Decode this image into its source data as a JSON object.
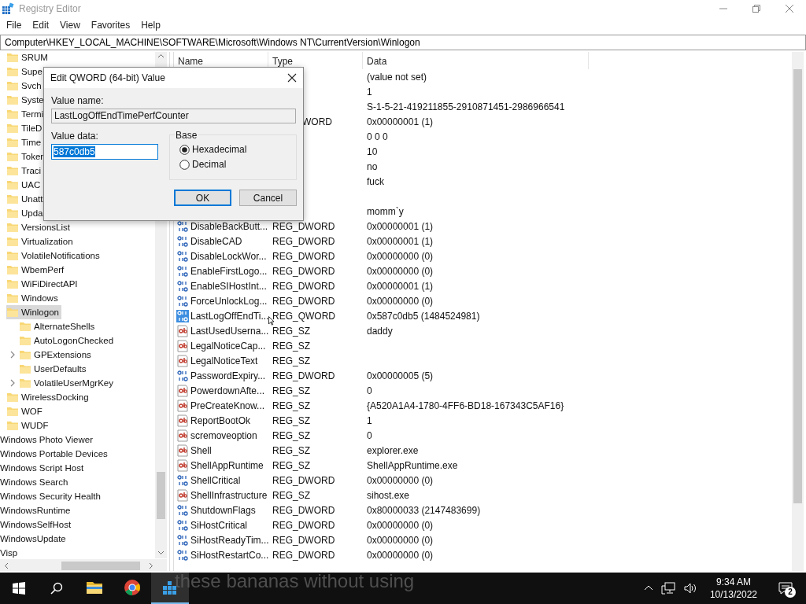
{
  "window": {
    "title": "Registry Editor"
  },
  "menu": [
    "File",
    "Edit",
    "View",
    "Favorites",
    "Help"
  ],
  "address": "Computer\\HKEY_LOCAL_MACHINE\\SOFTWARE\\Microsoft\\Windows NT\\CurrentVersion\\Winlogon",
  "tree": {
    "items": [
      {
        "children": [
          {
            "label": "SRUM",
            "selected": false
          },
          {
            "label": "Supe",
            "selected": false
          },
          {
            "label": "Svch",
            "selected": false
          },
          {
            "label": "Syste",
            "selected": false
          },
          {
            "label": "Termi",
            "selected": false
          },
          {
            "label": "TileD",
            "selected": false
          },
          {
            "label": "Time",
            "selected": false
          },
          {
            "label": "Toker",
            "selected": false
          },
          {
            "label": "Traci",
            "selected": false
          },
          {
            "label": "UAC",
            "selected": false
          },
          {
            "label": "Unatt",
            "selected": false
          },
          {
            "label": "Upda",
            "selected": false
          },
          {
            "label": "VersionsList",
            "selected": false
          },
          {
            "label": "Virtualization",
            "selected": false
          },
          {
            "label": "VolatileNotifications",
            "selected": false
          },
          {
            "label": "WbemPerf",
            "selected": false
          },
          {
            "label": "WiFiDirectAPI",
            "selected": false
          },
          {
            "label": "Windows",
            "selected": false
          },
          {
            "label": "Winlogon",
            "selected": true,
            "children": [
              {
                "label": "AlternateShells",
                "selected": false,
                "has_children": false
              },
              {
                "label": "AutoLogonChecked",
                "selected": false,
                "has_children": false
              },
              {
                "label": "GPExtensions",
                "selected": false,
                "has_children": true
              },
              {
                "label": "UserDefaults",
                "selected": false,
                "has_children": false
              },
              {
                "label": "VolatileUserMgrKey",
                "selected": false,
                "has_children": true
              }
            ]
          },
          {
            "label": "WirelessDocking",
            "selected": false
          },
          {
            "label": "WOF",
            "selected": false
          },
          {
            "label": "WUDF",
            "selected": false
          }
        ]
      },
      {
        "label": "Windows Photo Viewer",
        "selected": false
      },
      {
        "label": "Windows Portable Devices",
        "selected": false
      },
      {
        "label": "Windows Script Host",
        "selected": false
      },
      {
        "label": "Windows Search",
        "selected": false
      },
      {
        "label": "Windows Security Health",
        "selected": false
      },
      {
        "label": "WindowsRuntime",
        "selected": false
      },
      {
        "label": "WindowsSelfHost",
        "selected": false
      },
      {
        "label": "WindowsUpdate",
        "selected": false
      },
      {
        "label": "Visp",
        "selected": false
      }
    ]
  },
  "list": {
    "columns": [
      "Name",
      "Type",
      "Data"
    ],
    "rows": [
      {
        "data": "(value not set)"
      },
      {
        "data": "1"
      },
      {
        "data": "S-1-5-21-419211855-2910871451-2986966541"
      },
      {
        "type": "WORD",
        "data": "0x00000001 (1)"
      },
      {
        "data": "0 0 0"
      },
      {
        "data": "10"
      },
      {
        "data": "no"
      },
      {
        "data": "fuck"
      },
      {},
      {
        "data": "momm`y"
      },
      {
        "kind": "binary",
        "name": "DisableBackButt...",
        "type": "REG_DWORD",
        "data": "0x00000001 (1)",
        "selected": false
      },
      {
        "kind": "binary",
        "name": "DisableCAD",
        "type": "REG_DWORD",
        "data": "0x00000001 (1)",
        "selected": false
      },
      {
        "kind": "binary",
        "name": "DisableLockWor...",
        "type": "REG_DWORD",
        "data": "0x00000000 (0)",
        "selected": false
      },
      {
        "kind": "binary",
        "name": "EnableFirstLogo...",
        "type": "REG_DWORD",
        "data": "0x00000000 (0)",
        "selected": false
      },
      {
        "kind": "binary",
        "name": "EnableSIHostInt...",
        "type": "REG_DWORD",
        "data": "0x00000001 (1)",
        "selected": false
      },
      {
        "kind": "binary",
        "name": "ForceUnlockLog...",
        "type": "REG_DWORD",
        "data": "0x00000000 (0)",
        "selected": false
      },
      {
        "kind": "binary",
        "name": "LastLogOffEndTi...",
        "type": "REG_QWORD",
        "data": "0x587c0db5 (1484524981)",
        "selected": true
      },
      {
        "kind": "string",
        "name": "LastUsedUserna...",
        "type": "REG_SZ",
        "data": "daddy",
        "selected": false
      },
      {
        "kind": "string",
        "name": "LegalNoticeCap...",
        "type": "REG_SZ",
        "selected": false
      },
      {
        "kind": "string",
        "name": "LegalNoticeText",
        "type": "REG_SZ",
        "selected": false
      },
      {
        "kind": "binary",
        "name": "PasswordExpiry...",
        "type": "REG_DWORD",
        "data": "0x00000005 (5)",
        "selected": false
      },
      {
        "kind": "string",
        "name": "PowerdownAfte...",
        "type": "REG_SZ",
        "data": "0",
        "selected": false
      },
      {
        "kind": "string",
        "name": "PreCreateKnow...",
        "type": "REG_SZ",
        "data": "{A520A1A4-1780-4FF6-BD18-167343C5AF16}",
        "selected": false
      },
      {
        "kind": "string",
        "name": "ReportBootOk",
        "type": "REG_SZ",
        "data": "1",
        "selected": false
      },
      {
        "kind": "string",
        "name": "scremoveoption",
        "type": "REG_SZ",
        "data": "0",
        "selected": false
      },
      {
        "kind": "string",
        "name": "Shell",
        "type": "REG_SZ",
        "data": "explorer.exe",
        "selected": false
      },
      {
        "kind": "string",
        "name": "ShellAppRuntime",
        "type": "REG_SZ",
        "data": "ShellAppRuntime.exe",
        "selected": false
      },
      {
        "kind": "binary",
        "name": "ShellCritical",
        "type": "REG_DWORD",
        "data": "0x00000000 (0)",
        "selected": false
      },
      {
        "kind": "string",
        "name": "ShellInfrastructure",
        "type": "REG_SZ",
        "data": "sihost.exe",
        "selected": false
      },
      {
        "kind": "binary",
        "name": "ShutdownFlags",
        "type": "REG_DWORD",
        "data": "0x80000033 (2147483699)",
        "selected": false
      },
      {
        "kind": "binary",
        "name": "SiHostCritical",
        "type": "REG_DWORD",
        "data": "0x00000000 (0)",
        "selected": false
      },
      {
        "kind": "binary",
        "name": "SiHostReadyTim...",
        "type": "REG_DWORD",
        "data": "0x00000000 (0)",
        "selected": false
      },
      {
        "kind": "binary",
        "name": "SiHostRestartCo...",
        "type": "REG_DWORD",
        "data": "0x00000000 (0)",
        "selected": false
      }
    ]
  },
  "dialog": {
    "title": "Edit QWORD (64-bit) Value",
    "name_label": "Value name:",
    "name_value": "LastLogOffEndTimePerfCounter",
    "data_label": "Value data:",
    "data_value": "587c0db5",
    "base_label": "Base",
    "bases": [
      {
        "label": "Hexadecimal",
        "selected": true
      },
      {
        "label": "Decimal",
        "selected": false
      }
    ],
    "buttons": [
      {
        "label": "OK",
        "default": true
      },
      {
        "label": "Cancel",
        "default": false
      }
    ]
  },
  "taskbar": {
    "apps": [
      {
        "kind": "explorer",
        "active": false
      },
      {
        "kind": "browser",
        "active": false
      },
      {
        "kind": "regedit",
        "active": true
      }
    ],
    "time": "9:34 AM",
    "date": "10/13/2022",
    "notifications": "2"
  },
  "caption": "these bananas without using"
}
